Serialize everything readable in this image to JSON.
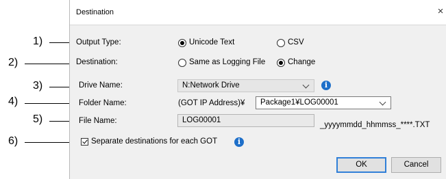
{
  "dialog": {
    "title": "Destination",
    "close_glyph": "×",
    "output_type": {
      "label": "Output Type:",
      "options": [
        "Unicode Text",
        "CSV"
      ],
      "selected": "Unicode Text"
    },
    "destination": {
      "label": "Destination:",
      "options": [
        "Same as Logging File",
        "Change"
      ],
      "selected": "Change"
    },
    "drive_name": {
      "label": "Drive Name:",
      "value": "N:Network Drive"
    },
    "folder_name": {
      "label": "Folder Name:",
      "prefix": "(GOT IP Address)¥",
      "value": "Package1¥LOG00001"
    },
    "file_name": {
      "label": "File Name:",
      "value": "LOG00001",
      "suffix": "_yyyymmdd_hhmmss_****.TXT"
    },
    "separate": {
      "label": "Separate destinations for each GOT",
      "checked": true
    },
    "buttons": {
      "ok": "OK",
      "cancel": "Cancel"
    },
    "info_glyph": "i"
  },
  "callouts": [
    "1)",
    "2)",
    "3)",
    "4)",
    "5)",
    "6)"
  ],
  "colors": {
    "info": "#1e6fc9",
    "default_button_border": "#2f7fd8",
    "dialog_bg": "#f0f0f0"
  }
}
